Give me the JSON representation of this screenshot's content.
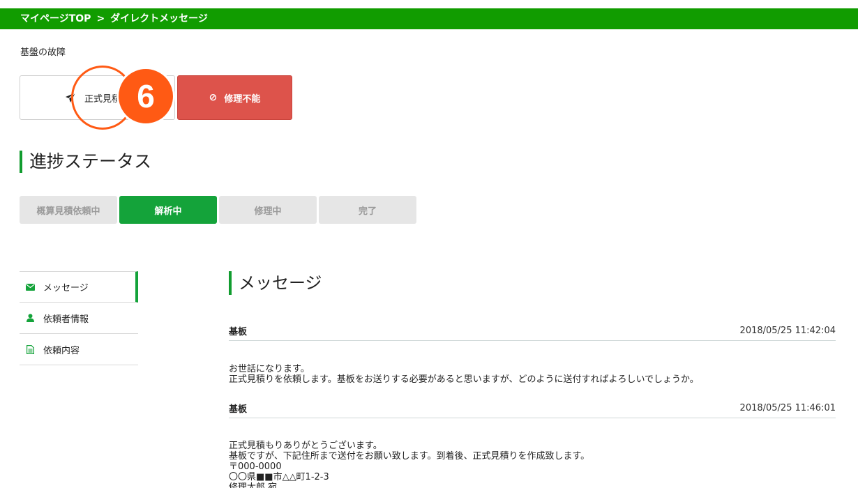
{
  "breadcrumb": {
    "home": "マイページTOP",
    "separator": ">",
    "current": "ダイレクトメッセージ"
  },
  "subject": "基盤の故障",
  "actions": {
    "quote_label": "正式見積り",
    "unable_label": "修理不能",
    "callout_number": "6"
  },
  "progress": {
    "title": "進捗ステータス",
    "steps": [
      "概算見積依頼中",
      "解析中",
      "修理中",
      "完了"
    ],
    "active_index": 1
  },
  "sidenav": {
    "items": [
      "メッセージ",
      "依頼者情報",
      "依頼内容"
    ]
  },
  "messages": {
    "title": "メッセージ",
    "list": [
      {
        "from": "基板",
        "time": "2018/05/25 11:42:04",
        "body": "お世話になります。\n正式見積りを依頼します。基板をお送りする必要があると思いますが、どのように送付すればよろしいでしょうか。"
      },
      {
        "from": "基板",
        "time": "2018/05/25 11:46:01",
        "body": "正式見積もりありがとうございます。\n基板ですが、下記住所まで送付をお願い致します。到着後、正式見積りを作成致します。\n〒000-0000\n〇〇県■■市△△町1-2-3\n修理太郎 宛"
      }
    ]
  },
  "colors": {
    "brand_green": "#119c00",
    "active_green": "#14a33a",
    "danger": "#dd534b",
    "callout": "#ff5a14"
  }
}
